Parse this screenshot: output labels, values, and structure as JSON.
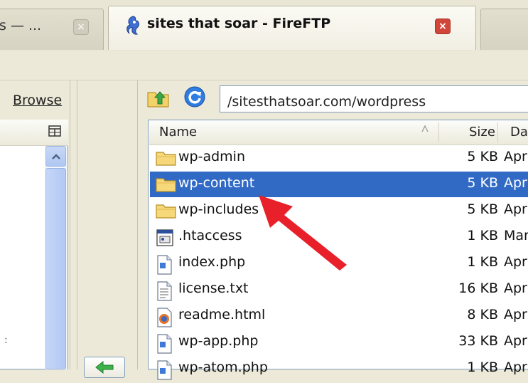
{
  "tabs": {
    "prev_tab_title": "s — ...",
    "active_tab_title": "sites that soar - FireFTP",
    "close_glyph": "×"
  },
  "local": {
    "browse_label": "Browse",
    "partial_text": ":"
  },
  "remote": {
    "path": "/sitesthatsoar.com/wordpress",
    "columns": {
      "name": "Name",
      "size": "Size",
      "date": "Da"
    },
    "files": [
      {
        "name": "wp-admin",
        "size": "5 KB",
        "date": "Apr",
        "icon": "folder-icon",
        "selected": false
      },
      {
        "name": "wp-content",
        "size": "5 KB",
        "date": "Apr",
        "icon": "folder-icon",
        "selected": true
      },
      {
        "name": "wp-includes",
        "size": "5 KB",
        "date": "Apr",
        "icon": "folder-icon",
        "selected": false
      },
      {
        "name": ".htaccess",
        "size": "1 KB",
        "date": "Mar",
        "icon": "htaccess-file-icon",
        "selected": false
      },
      {
        "name": "index.php",
        "size": "1 KB",
        "date": "Apr",
        "icon": "php-file-icon",
        "selected": false
      },
      {
        "name": "license.txt",
        "size": "16 KB",
        "date": "Apr",
        "icon": "text-file-icon",
        "selected": false
      },
      {
        "name": "readme.html",
        "size": "8 KB",
        "date": "Apr",
        "icon": "html-file-icon",
        "selected": false
      },
      {
        "name": "wp-app.php",
        "size": "33 KB",
        "date": "Apr",
        "icon": "php-file-icon",
        "selected": false
      },
      {
        "name": "wp-atom.php",
        "size": "1 KB",
        "date": "Apr",
        "icon": "php-file-icon",
        "selected": false
      }
    ]
  },
  "colors": {
    "selection": "#316ac5",
    "annotation_arrow": "#e8202a",
    "field_border": "#7f9db9"
  }
}
